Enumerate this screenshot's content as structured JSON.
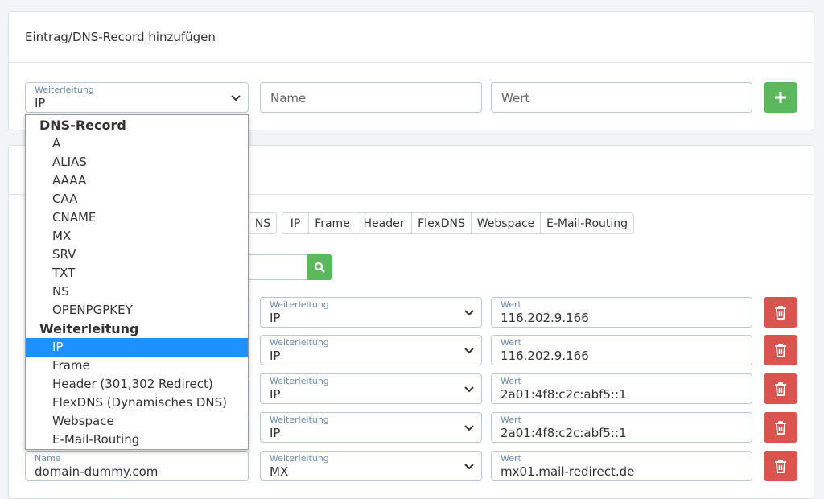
{
  "add_card": {
    "title": "Eintrag/DNS-Record hinzufügen",
    "type_select": {
      "label": "Weiterleitung",
      "value": "IP"
    },
    "name_placeholder": "Name",
    "value_placeholder": "Wert",
    "add_icon": "plus-icon"
  },
  "dropdown": {
    "groups": [
      {
        "label": "DNS-Record",
        "options": [
          "A",
          "ALIAS",
          "AAAA",
          "CAA",
          "CNAME",
          "MX",
          "SRV",
          "TXT",
          "NS",
          "OPENPGPKEY"
        ]
      },
      {
        "label": "Weiterleitung",
        "options": [
          "IP",
          "Frame",
          "Header (301,302 Redirect)",
          "FlexDNS (Dynamisches DNS)",
          "Webspace",
          "E-Mail-Routing"
        ]
      }
    ],
    "selected": "IP"
  },
  "filters": [
    "NS",
    "IP",
    "Frame",
    "Header",
    "FlexDNS",
    "Webspace",
    "E-Mail-Routing"
  ],
  "search_icon": "search-icon",
  "records": [
    {
      "type_label": "Weiterleitung",
      "type": "IP",
      "value_label": "Wert",
      "value": "116.202.9.166"
    },
    {
      "type_label": "Weiterleitung",
      "type": "IP",
      "value_label": "Wert",
      "value": "116.202.9.166"
    },
    {
      "type_label": "Weiterleitung",
      "type": "IP",
      "value_label": "Wert",
      "value": "2a01:4f8:c2c:abf5::1"
    },
    {
      "type_label": "Weiterleitung",
      "type": "IP",
      "value_label": "Wert",
      "value": "2a01:4f8:c2c:abf5::1"
    },
    {
      "name_label": "Name",
      "name": "domain-dummy.com",
      "type_label": "Weiterleitung",
      "type": "MX",
      "value_label": "Wert",
      "value": "mx01.mail-redirect.de"
    }
  ],
  "delete_icon": "trash-icon",
  "colors": {
    "success": "#5cb85c",
    "danger": "#d9534f",
    "selected": "#1e90ff",
    "label": "#6a8bb3"
  }
}
